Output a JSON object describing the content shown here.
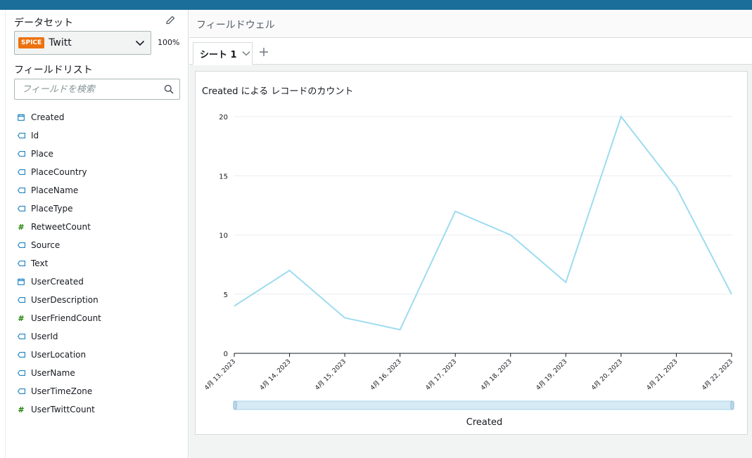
{
  "sidebar": {
    "dataset_title": "データセット",
    "spice_badge": "SPICE",
    "dataset_name": "Twitt",
    "usage_percent": "100%",
    "field_list_title": "フィールドリスト",
    "search_placeholder": "フィールドを検索",
    "fields": [
      {
        "name": "Created",
        "type": "date"
      },
      {
        "name": "Id",
        "type": "string"
      },
      {
        "name": "Place",
        "type": "string"
      },
      {
        "name": "PlaceCountry",
        "type": "string"
      },
      {
        "name": "PlaceName",
        "type": "string"
      },
      {
        "name": "PlaceType",
        "type": "string"
      },
      {
        "name": "RetweetCount",
        "type": "number"
      },
      {
        "name": "Source",
        "type": "string"
      },
      {
        "name": "Text",
        "type": "string"
      },
      {
        "name": "UserCreated",
        "type": "date"
      },
      {
        "name": "UserDescription",
        "type": "string"
      },
      {
        "name": "UserFriendCount",
        "type": "number"
      },
      {
        "name": "UserId",
        "type": "string"
      },
      {
        "name": "UserLocation",
        "type": "string"
      },
      {
        "name": "UserName",
        "type": "string"
      },
      {
        "name": "UserTimeZone",
        "type": "string"
      },
      {
        "name": "UserTwittCount",
        "type": "number"
      }
    ]
  },
  "main": {
    "field_wells_label": "フィールドウェル",
    "tabs": [
      {
        "label": "シート 1"
      }
    ],
    "visual_title": "Created による レコードのカウント"
  },
  "colors": {
    "line": "#9ddcef",
    "date_icon": "#0073bb",
    "string_icon": "#0073bb",
    "number_icon": "#1d8102",
    "topbar": "#1b6d9a",
    "spice": "#ec7211"
  },
  "chart_data": {
    "type": "line",
    "title": "Created による レコードのカウント",
    "xlabel": "Created",
    "ylabel": "",
    "categories": [
      "4月 13, 2023",
      "4月 14, 2023",
      "4月 15, 2023",
      "4月 16, 2023",
      "4月 17, 2023",
      "4月 18, 2023",
      "4月 19, 2023",
      "4月 20, 2023",
      "4月 21, 2023",
      "4月 22, 2023"
    ],
    "values": [
      4,
      7,
      3,
      2,
      12,
      10,
      6,
      20,
      14,
      5
    ],
    "yticks": [
      0,
      5,
      10,
      15,
      20
    ],
    "ylim": [
      0,
      20
    ],
    "grid": true,
    "legend": "none"
  }
}
